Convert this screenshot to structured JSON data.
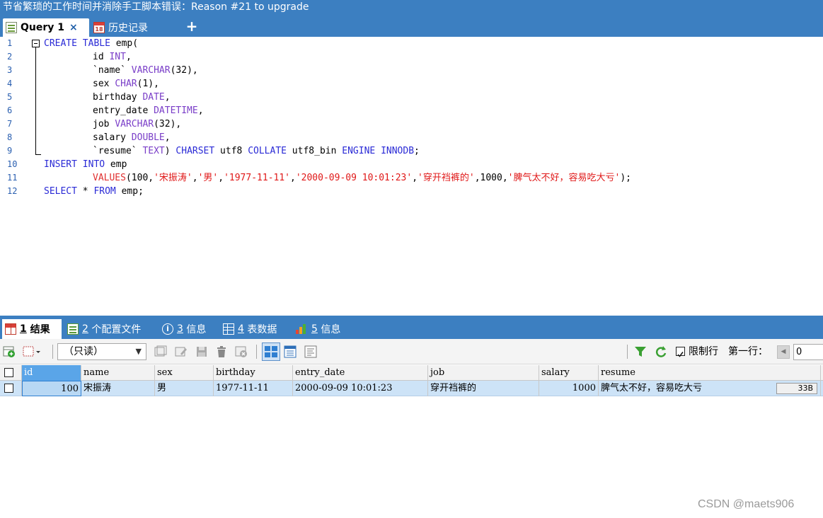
{
  "window": {
    "title": "节省繁琐的工作时间并消除手工脚本错误：Reason #21 to upgrade"
  },
  "editor_tabs": {
    "query": {
      "label": "Query 1",
      "close": "×"
    },
    "history": {
      "label": "历史记录",
      "icon_text": "18"
    },
    "add": "+"
  },
  "editor": {
    "line_numbers": [
      "1",
      "2",
      "3",
      "4",
      "5",
      "6",
      "7",
      "8",
      "9",
      "10",
      "11",
      "12"
    ],
    "sql": [
      "CREATE TABLE emp(",
      "\tid INT,",
      "\t`name` VARCHAR(32),",
      "\tsex CHAR(1),",
      "\tbirthday DATE,",
      "\tentry_date DATETIME,",
      "\tjob VARCHAR(32),",
      "\tsalary DOUBLE,",
      "\t`resume` TEXT) CHARSET utf8 COLLATE utf8_bin ENGINE INNODB;",
      "INSERT INTO emp",
      "\tVALUES(100,'宋振涛','男','1977-11-11','2000-09-09 10:01:23','穿开裆裤的',1000,'脾气太不好，容易吃大亏');",
      "SELECT * FROM emp;"
    ]
  },
  "result_tabs": [
    {
      "num": "1",
      "label": "结果",
      "active": true
    },
    {
      "num": "2",
      "label": "个配置文件"
    },
    {
      "num": "3",
      "label": "信息"
    },
    {
      "num": "4",
      "label": "表数据"
    },
    {
      "num": "5",
      "label": "信息"
    }
  ],
  "toolbar": {
    "readonly_select": "（只读）",
    "limit_rows_label": "限制行",
    "first_row_label": "第一行：",
    "first_row_value": "0",
    "limit_rows_checked": true
  },
  "grid": {
    "columns": [
      "id",
      "name",
      "sex",
      "birthday",
      "entry_date",
      "job",
      "salary",
      "resume"
    ],
    "rows": [
      {
        "id": "100",
        "name": "宋振涛",
        "sex": "男",
        "birthday": "1977-11-11",
        "entry_date": "2000-09-09 10:01:23",
        "job": "穿开裆裤的",
        "salary": "1000",
        "resume": "脾气太不好，容易吃大亏",
        "resume_size": "33B"
      }
    ]
  },
  "watermark": "CSDN @maets906",
  "colors": {
    "accent": "#3c7fc1",
    "selected_row": "#cde3f7",
    "keyword": "#2a2ad6",
    "type": "#7a3ec8",
    "string": "#e01818"
  },
  "icons": {
    "query_tab": "query-doc-icon",
    "history_tab": "calendar-icon",
    "result_tab": "grid-icon",
    "profile_tab": "profile-doc-icon",
    "info_tab": "info-icon",
    "table_data_tab": "table-icon",
    "info2_tab": "bar-chart-icon",
    "filter": "filter-icon",
    "refresh": "refresh-icon"
  }
}
